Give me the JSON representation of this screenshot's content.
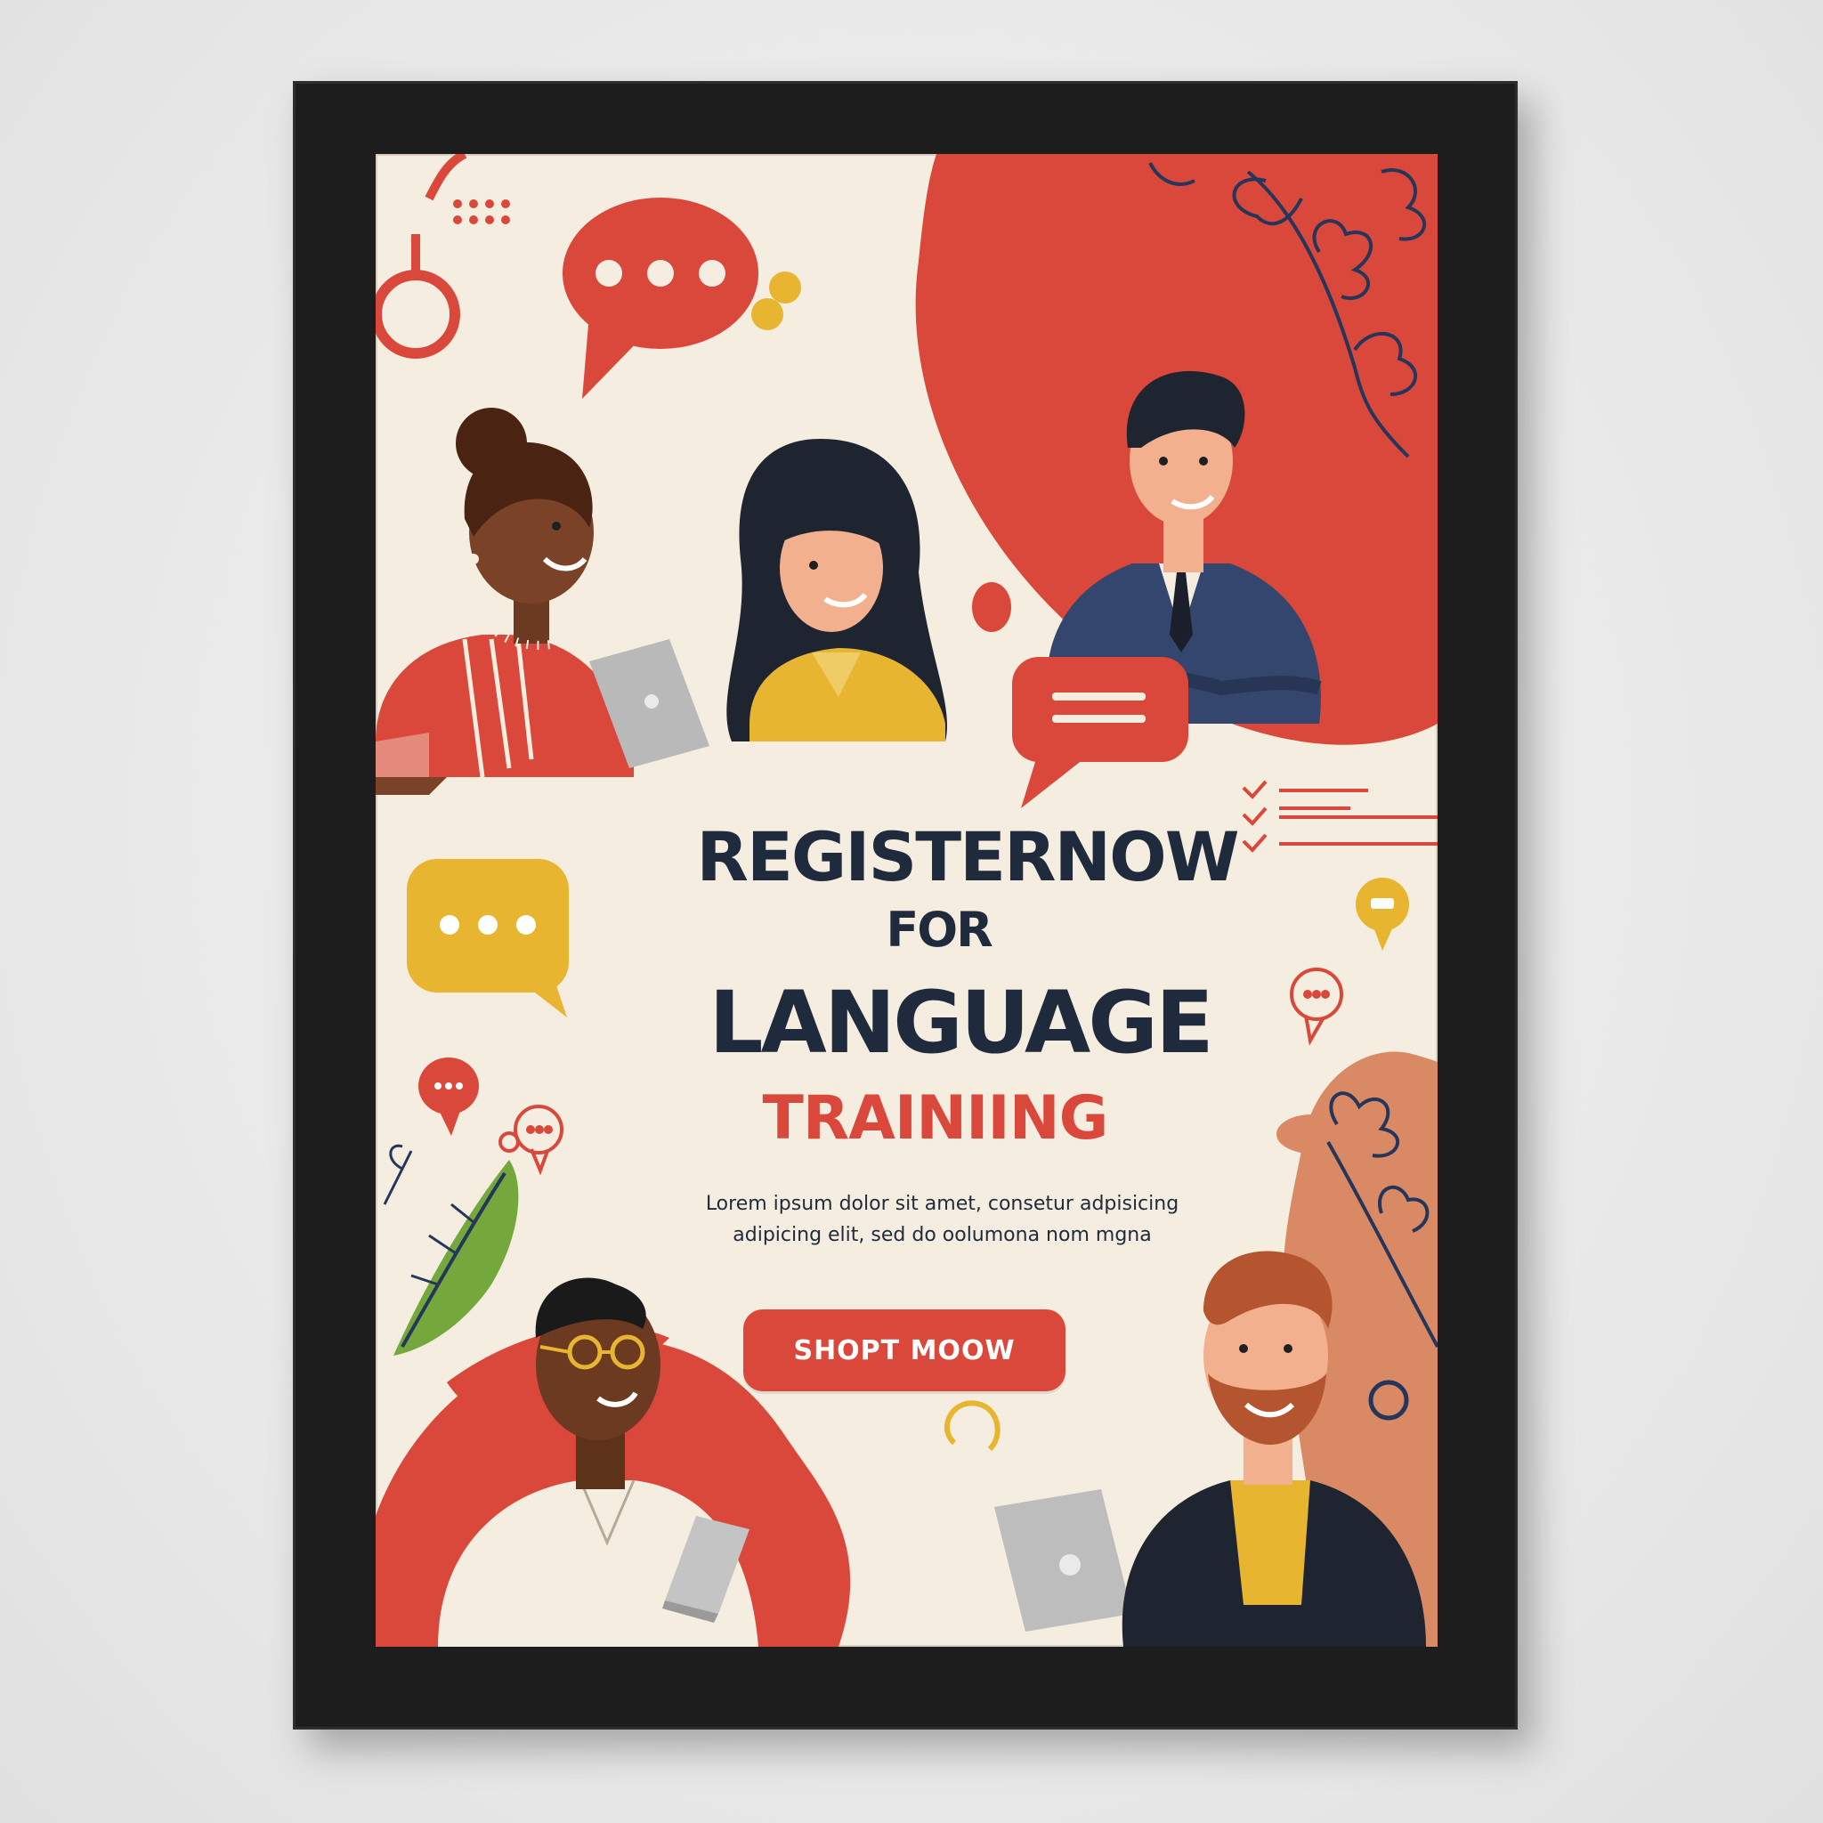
{
  "poster": {
    "headline_line1": "REGISTERNOW",
    "headline_line2": "FOR",
    "headline_line3": "LANGUAGE",
    "headline_line4": "TRAINIING",
    "body_line1": "Lorem ipsum dolor sit amet, consetur adpisicing",
    "body_line2": "adipicing elit, sed do oolumona nom mgna",
    "cta_label": "SHOPT MOOW"
  },
  "colors": {
    "background": "#f4ede0",
    "accent_red": "#d9483a",
    "accent_yellow": "#e8b531",
    "navy": "#1f2a3c",
    "frame": "#1d1d1d"
  },
  "icons": [
    "speech-bubble-icon",
    "chat-icon",
    "checklist-icon",
    "laptop-icon",
    "leaf-icon",
    "dots-grid-icon"
  ]
}
